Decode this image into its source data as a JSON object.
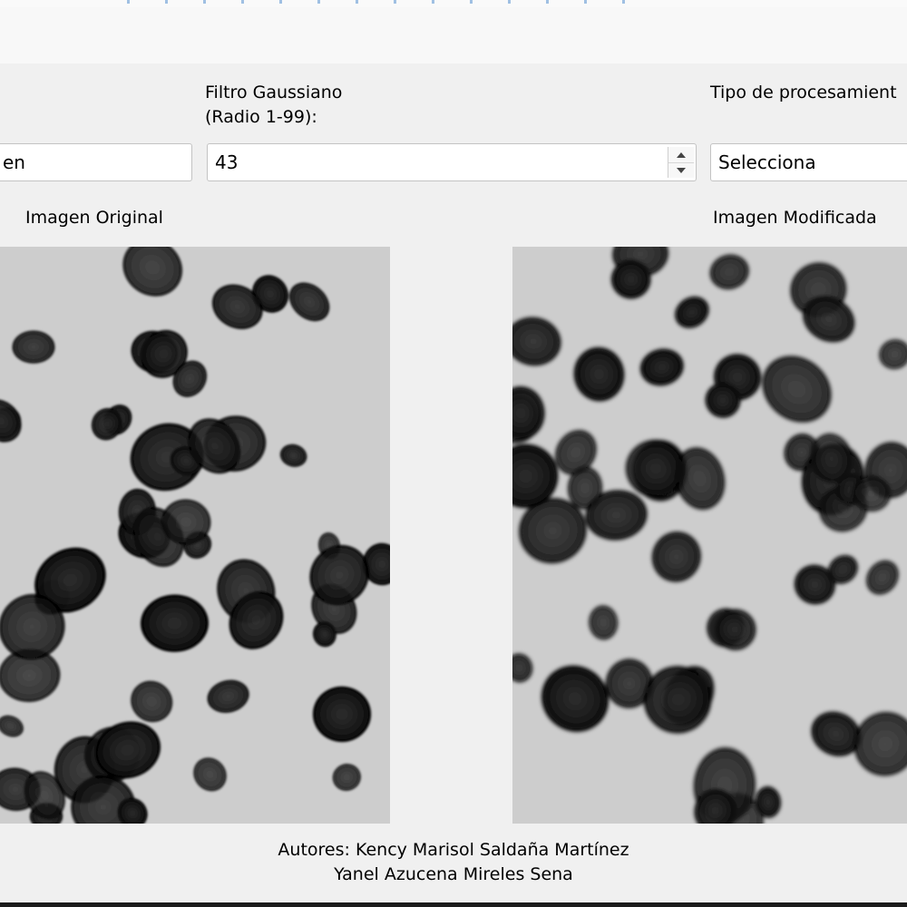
{
  "controls": {
    "gaussian_filter_label_line1": "Filtro Gaussiano",
    "gaussian_filter_label_line2": "(Radio 1-99):",
    "gaussian_radius_value": "43",
    "processing_type_label": "Tipo de procesamient",
    "processing_type_value": "Selecciona",
    "left_field_value": "en"
  },
  "images": {
    "original_label": "Imagen Original",
    "modified_label": "Imagen Modificada"
  },
  "footer": {
    "authors_line1": "Autores: Kency Marisol Saldaña Martínez",
    "authors_line2": "Yanel Azucena Mireles Sena"
  },
  "colors": {
    "window_bg": "#f0f0f0",
    "field_border": "#c3c3c3",
    "spot_dark": "#151515",
    "image_bg": "#c8c8c8"
  },
  "icons": {
    "spinner": "up-down-arrows",
    "dropdown": "chevron-down-icon"
  }
}
